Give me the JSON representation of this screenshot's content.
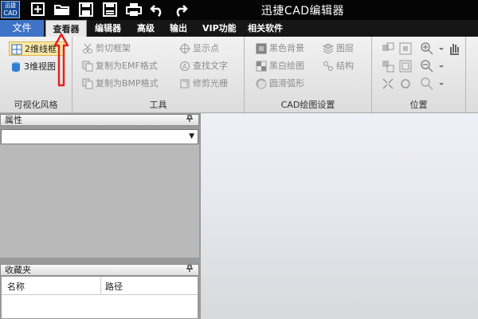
{
  "app": {
    "logo_line1": "迅捷",
    "logo_line2": "CAD",
    "title": "迅捷CAD编辑器"
  },
  "quick_access": [
    "new-icon",
    "open-folder-icon",
    "save-icon",
    "save-as-icon",
    "print-icon",
    "undo-icon",
    "redo-icon"
  ],
  "menu": {
    "file": "文件",
    "items": [
      "查看器",
      "编辑器",
      "高级",
      "输出",
      "VIP功能",
      "相关软件"
    ]
  },
  "ribbon": {
    "visual_style": {
      "label": "可视化风格",
      "btn_2d": "2维线框",
      "btn_3d": "3维视图"
    },
    "tools": {
      "label": "工具",
      "items": [
        "剪切框架",
        "复制为EMF格式",
        "复制为BMP格式",
        "显示点",
        "查找文字",
        "修剪光栅"
      ]
    },
    "cad_settings": {
      "label": "CAD绘图设置",
      "items": [
        "黑色背景",
        "黑白绘图",
        "圆滑弧形",
        "图层",
        "结构"
      ]
    },
    "position": {
      "label": "位置"
    }
  },
  "panels": {
    "properties": {
      "title": "属性",
      "pin": "📌"
    },
    "favorites": {
      "title": "收藏夹",
      "pin": "📌",
      "columns": [
        "名称",
        "路径"
      ]
    }
  },
  "colors": {
    "accent_blue": "#3f73c7",
    "annotation_red": "#e0241b"
  }
}
